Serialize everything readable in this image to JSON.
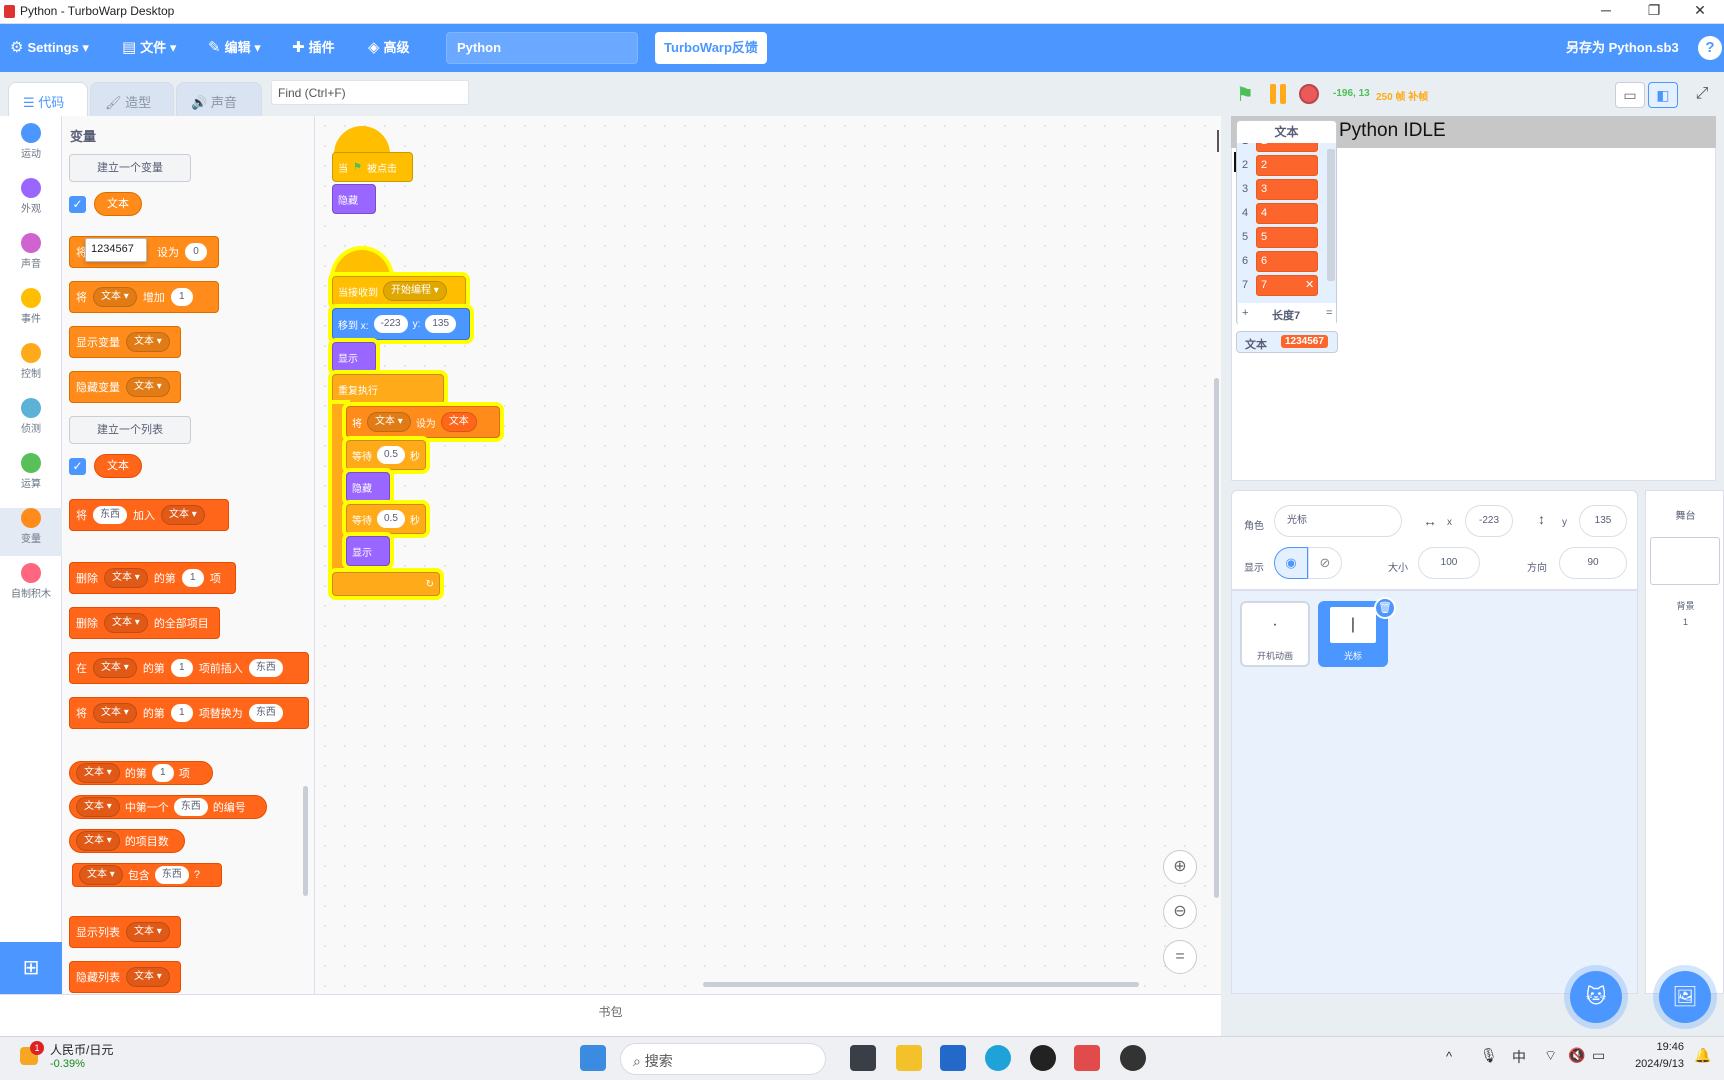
{
  "window": {
    "title": "Python - TurboWarp Desktop"
  },
  "menu": {
    "settings": "Settings",
    "file": "文件",
    "edit": "编辑",
    "addons": "插件",
    "advanced": "高级",
    "project_name": "Python",
    "feedback": "TurboWarp反馈",
    "save_as": "另存为 Python.sb3",
    "help": "?"
  },
  "tabs": {
    "code": "代码",
    "costumes": "造型",
    "sounds": "声音"
  },
  "find": {
    "label": "Find (Ctrl+F)"
  },
  "categories": [
    {
      "label": "运动",
      "color": "#4c97ff"
    },
    {
      "label": "外观",
      "color": "#9966ff"
    },
    {
      "label": "声音",
      "color": "#cf63cf"
    },
    {
      "label": "事件",
      "color": "#ffbf00"
    },
    {
      "label": "控制",
      "color": "#ffab19"
    },
    {
      "label": "侦测",
      "color": "#5cb1d6"
    },
    {
      "label": "运算",
      "color": "#59c059"
    },
    {
      "label": "变量",
      "color": "#ff8c1a"
    },
    {
      "label": "自制积木",
      "color": "#ff6680"
    }
  ],
  "palette": {
    "title": "变量",
    "make_variable": "建立一个变量",
    "var_name": "文本",
    "tooltip": "1234567",
    "set_to": "设为",
    "change_by": "增加",
    "zero": "0",
    "one": "1",
    "jiang": "将",
    "show_var": "显示变量",
    "hide_var": "隐藏变量",
    "make_list": "建立一个列表",
    "list_name": "文本",
    "thing": "东西",
    "add_to": "加入",
    "delete": "删除",
    "item_of": "的第",
    "item": "项",
    "delete_all": "的全部项目",
    "in": "在",
    "insert_before": "项前插入",
    "replace_with": "项替换为",
    "first_index": "中第一个",
    "index_of": "的编号",
    "length_of": "的项目数",
    "contains": "包含",
    "q": "?",
    "show_list": "显示列表",
    "hide_list": "隐藏列表"
  },
  "script": {
    "when_flag": "当",
    "clicked": "被点击",
    "hide": "隐藏",
    "when_receive": "当接收到",
    "broadcast": "开始编程",
    "goto": "移到 x:",
    "x": "-223",
    "y_lbl": "y:",
    "y": "135",
    "show": "显示",
    "forever": "重复执行",
    "set": "将",
    "var": "文本",
    "set_to": "设为",
    "value": "文本",
    "wait": "等待",
    "secs": "0.5",
    "sec_unit": "秒"
  },
  "backpack": "书包",
  "stage": {
    "coords": "-196, 13",
    "fps": "250 帧",
    "fps_extra": "补帧",
    "idle_title": "Python  IDLE"
  },
  "list_monitor": {
    "title": "文本",
    "items": [
      "1",
      "2",
      "3",
      "4",
      "5",
      "6",
      "7"
    ],
    "length": "长度7",
    "plus": "+",
    "eq": "="
  },
  "var_monitor": {
    "name": "文本",
    "value": "1234567"
  },
  "sprite_info": {
    "sprite_label": "角色",
    "sprite_name": "光标",
    "x_label": "x",
    "x": "-223",
    "y_label": "y",
    "y": "135",
    "show_label": "显示",
    "size_label": "大小",
    "size": "100",
    "dir_label": "方向",
    "direction": "90"
  },
  "sprites": [
    {
      "name": "开机动画",
      "selected": false
    },
    {
      "name": "光标",
      "selected": true
    }
  ],
  "stage_pane": {
    "title": "舞台",
    "backdrops_label": "背景",
    "backdrops_count": "1"
  },
  "taskbar": {
    "stock_name": "人民币/日元",
    "stock_change": "-0.39%",
    "badge": "1",
    "search": "搜索",
    "ime": "中",
    "time": "19:46",
    "date": "2024/9/13"
  }
}
